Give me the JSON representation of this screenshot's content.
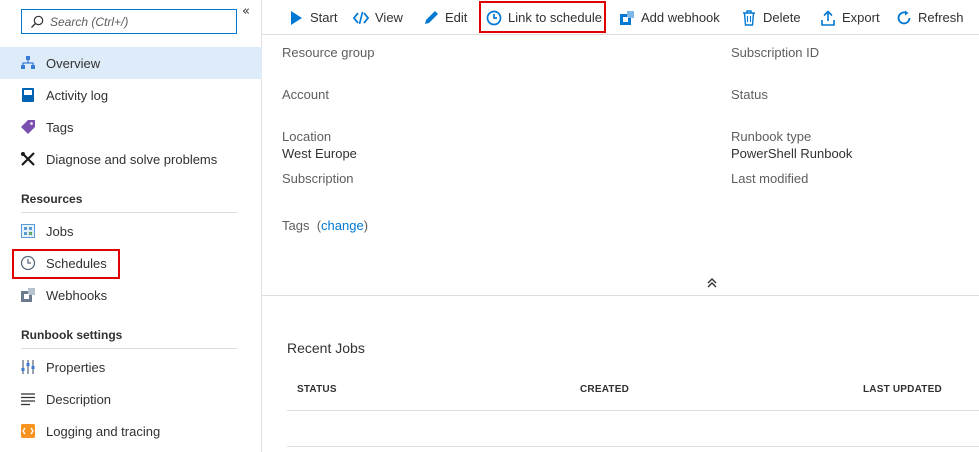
{
  "sidebar": {
    "search_placeholder": "Search (Ctrl+/)",
    "collapse_glyph": "«",
    "items": [
      {
        "label": "Overview",
        "icon": "overview-icon"
      },
      {
        "label": "Activity log",
        "icon": "activity-log-icon"
      },
      {
        "label": "Tags",
        "icon": "tag-icon"
      },
      {
        "label": "Diagnose and solve problems",
        "icon": "wrench-icon"
      }
    ],
    "sections": [
      {
        "title": "Resources",
        "items": [
          {
            "label": "Jobs",
            "icon": "jobs-icon"
          },
          {
            "label": "Schedules",
            "icon": "clock-icon"
          },
          {
            "label": "Webhooks",
            "icon": "webhook-icon"
          }
        ]
      },
      {
        "title": "Runbook settings",
        "items": [
          {
            "label": "Properties",
            "icon": "properties-icon"
          },
          {
            "label": "Description",
            "icon": "description-icon"
          },
          {
            "label": "Logging and tracing",
            "icon": "logging-icon"
          }
        ]
      }
    ]
  },
  "toolbar": {
    "start": "Start",
    "view": "View",
    "edit": "Edit",
    "link_to_schedule": "Link to schedule",
    "add_webhook": "Add webhook",
    "delete": "Delete",
    "export": "Export",
    "refresh": "Refresh"
  },
  "essentials": {
    "resource_group_label": "Resource group",
    "account_label": "Account",
    "location_label": "Location",
    "location_value": "West Europe",
    "subscription_label": "Subscription",
    "subscription_id_label": "Subscription ID",
    "status_label": "Status",
    "runbook_type_label": "Runbook type",
    "runbook_type_value": "PowerShell Runbook",
    "last_modified_label": "Last modified",
    "tags_label": "Tags",
    "tags_change": "change"
  },
  "recent_jobs": {
    "title": "Recent Jobs",
    "columns": [
      "STATUS",
      "CREATED",
      "LAST UPDATED"
    ]
  },
  "colors": {
    "accent": "#0078d4",
    "highlight": "#e00000",
    "active_bg": "#deecf9"
  }
}
